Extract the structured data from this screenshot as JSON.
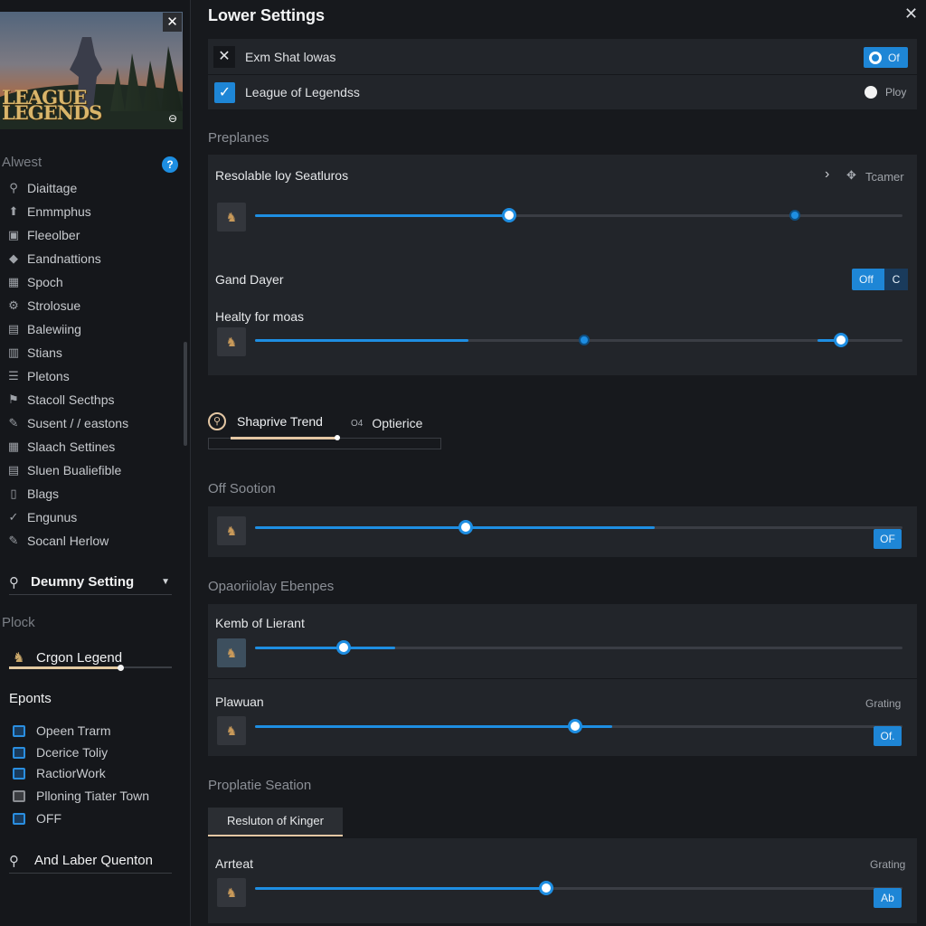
{
  "sidebar": {
    "banner_logo_line1": "LEAGUE",
    "banner_logo_line2": "LEGENDS",
    "heading1": "Alwest",
    "help_icon": "?",
    "items": [
      {
        "label": "Diaittage",
        "icon": "search-icon"
      },
      {
        "label": "Enmmphus",
        "icon": "arrow-up-icon"
      },
      {
        "label": "Fleeolber",
        "icon": "image-icon"
      },
      {
        "label": "Eandnattions",
        "icon": "diamond-icon"
      },
      {
        "label": "Spoch",
        "icon": "grid-icon"
      },
      {
        "label": "Strolosue",
        "icon": "gear-icon"
      },
      {
        "label": "Balewiing",
        "icon": "book-icon"
      },
      {
        "label": "Stians",
        "icon": "table-icon"
      },
      {
        "label": "Pletons",
        "icon": "list-icon"
      },
      {
        "label": "Stacoll Secthps",
        "icon": "flag-icon"
      },
      {
        "label": "Susent / / eastons",
        "icon": "chat-icon"
      },
      {
        "label": "Slaach Settines",
        "icon": "grid-icon"
      },
      {
        "label": "Sluen Bualiefible",
        "icon": "stack-icon"
      },
      {
        "label": "Blags",
        "icon": "file-icon"
      },
      {
        "label": "Engunus",
        "icon": "check-icon"
      },
      {
        "label": "Socanl Herlow",
        "icon": "pen-icon"
      }
    ],
    "dummy_setting": "Deumny Setting",
    "heading2": "Plock",
    "crgon": "Crgon Legend",
    "crgon_progress": 0.69,
    "eponts_heading": "Eponts",
    "eponts": [
      {
        "label": "Opeen Trarm",
        "box": "blue"
      },
      {
        "label": "Dcerice Toliy",
        "box": "blue"
      },
      {
        "label": "RactiorWork",
        "box": "blue"
      },
      {
        "label": "Plloning Tiater Town",
        "box": "gray"
      },
      {
        "label": "OFF",
        "box": "blue"
      }
    ],
    "and_laber": "And Laber Quenton"
  },
  "main": {
    "title": "Lower Settings",
    "top": {
      "label1": "Exm Shat lowas",
      "toggle1": "Of",
      "label2": "League of Legendss",
      "play": "Ploy"
    },
    "section1": "Preplanes",
    "row1": {
      "label": "Resolable loy Seatluros",
      "right": "Tcamer",
      "value": 0.392,
      "marker": 0.834
    },
    "row2": {
      "label": "Gand Dayer",
      "toggle": "Off",
      "toggle_end": "C"
    },
    "row3": {
      "label": "Healty for moas",
      "fill_a": 0.33,
      "marker": 0.509,
      "value": 0.905
    },
    "tabs": {
      "t1": "Shaprive Trend",
      "t1_icon": "compass-icon",
      "t2": "Optierice",
      "t2_icon": "eye-icon",
      "t2_icon_text": "O4"
    },
    "section2": "Off Sootion",
    "row4": {
      "label_btn": "OF",
      "value": 0.325,
      "fill_to": 0.618
    },
    "section3": "Opaoriiolay Ebenpes",
    "row5": {
      "label": "Kemb of Lierant",
      "value": 0.137,
      "fill_to": 0.217
    },
    "row6": {
      "label": "Plawuan",
      "right": "Grating",
      "btn": "Of.",
      "value": 0.494,
      "fill_to": 0.552
    },
    "section4": "Proplatie Seation",
    "resluton_tab": "Resluton of Kinger",
    "row7": {
      "label": "Arrteat",
      "right": "Grating",
      "btn": "Ab",
      "value": 0.45
    }
  },
  "colors": {
    "accent": "#1e86d6",
    "gold": "#e4c7a4",
    "panel": "#22252a",
    "background": "#17191d"
  }
}
